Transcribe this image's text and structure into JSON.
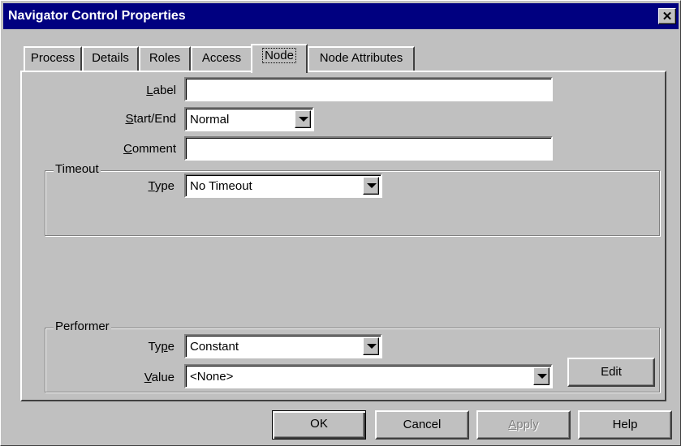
{
  "window": {
    "title": "Navigator Control Properties",
    "close_symbol": "✕"
  },
  "tabs": [
    {
      "label": "Process",
      "active": false
    },
    {
      "label": "Details",
      "active": false
    },
    {
      "label": "Roles",
      "active": false
    },
    {
      "label": "Access",
      "active": false
    },
    {
      "label": "Node",
      "active": true
    },
    {
      "label": "Node Attributes",
      "active": false
    }
  ],
  "node": {
    "label_field": {
      "label_prefix": "",
      "label_hotkey": "L",
      "label_rest": "abel",
      "value": ""
    },
    "start_end": {
      "label_hotkey": "S",
      "label_rest": "tart/End",
      "value": "Normal"
    },
    "comment": {
      "label_hotkey": "C",
      "label_rest": "omment",
      "value": ""
    },
    "timeout": {
      "group_title": "Timeout",
      "type_hotkey": "T",
      "type_rest": "ype",
      "type_value": "No Timeout"
    },
    "performer": {
      "group_title": "Performer",
      "type_prefix": "Ty",
      "type_hotkey": "p",
      "type_rest": "e",
      "type_value": "Constant",
      "value_hotkey": "V",
      "value_rest": "alue",
      "value_value": "<None>",
      "edit_label": "Edit"
    }
  },
  "buttons": {
    "ok": "OK",
    "cancel": "Cancel",
    "apply_hotkey": "A",
    "apply_rest": "pply",
    "help": "Help"
  }
}
